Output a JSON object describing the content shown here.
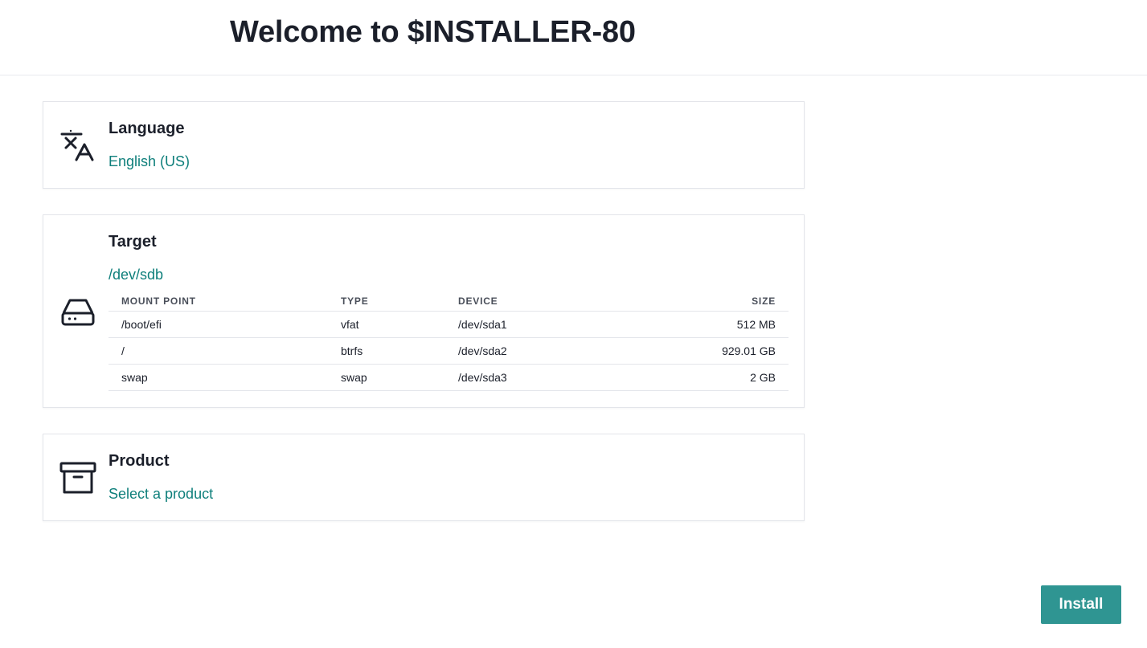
{
  "header": {
    "title": "Welcome to $INSTALLER-80"
  },
  "language": {
    "title": "Language",
    "value": "English (US)",
    "icon": "translate-icon"
  },
  "target": {
    "title": "Target",
    "device": "/dev/sdb",
    "icon": "hard-drive-icon",
    "columns": [
      "MOUNT POINT",
      "TYPE",
      "DEVICE",
      "SIZE"
    ],
    "rows": [
      {
        "mount": "/boot/efi",
        "type": "vfat",
        "device": "/dev/sda1",
        "size": "512 MB"
      },
      {
        "mount": "/",
        "type": "btrfs",
        "device": "/dev/sda2",
        "size": "929.01 GB"
      },
      {
        "mount": "swap",
        "type": "swap",
        "device": "/dev/sda3",
        "size": "2 GB"
      }
    ]
  },
  "product": {
    "title": "Product",
    "value": "Select a product",
    "icon": "archive-box-icon"
  },
  "actions": {
    "install_label": "Install"
  },
  "colors": {
    "accent": "#2f9592",
    "link": "#0e7f7b",
    "text": "#1b1f2a"
  }
}
